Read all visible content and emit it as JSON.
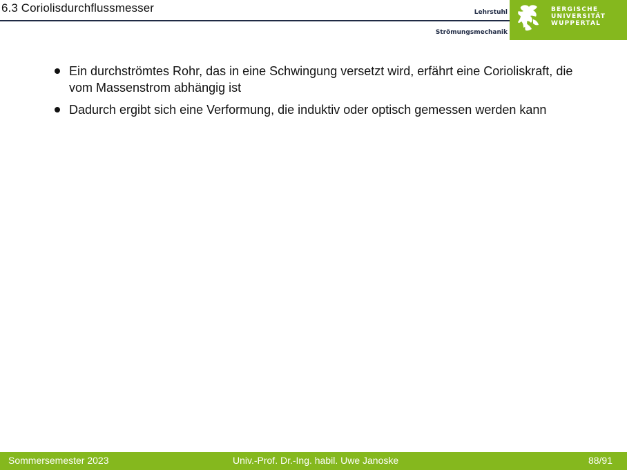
{
  "header": {
    "title": "6.3 Coriolisdurchflussmesser",
    "chair_line1": "Lehrstuhl",
    "chair_line2": "Strömungsmechanik",
    "logo": {
      "line1": "BERGISCHE",
      "line2": "UNIVERSITÄT",
      "line3": "WUPPERTAL",
      "icon": "university-lion-crest-icon"
    }
  },
  "content": {
    "bullets": [
      "Ein durchströmtes Rohr, das in eine Schwingung versetzt wird, erfährt eine Corioliskraft, die vom Massenstrom abhängig ist",
      "Dadurch ergibt sich eine Verformung, die induktiv oder optisch gemessen werden kann"
    ]
  },
  "footer": {
    "semester": "Sommersemester 2023",
    "author": "Univ.-Prof. Dr.-Ing. habil. Uwe Janoske",
    "page": "88/91"
  },
  "colors": {
    "accent": "#85b81e",
    "navy": "#1f2a44",
    "text": "#111111"
  }
}
